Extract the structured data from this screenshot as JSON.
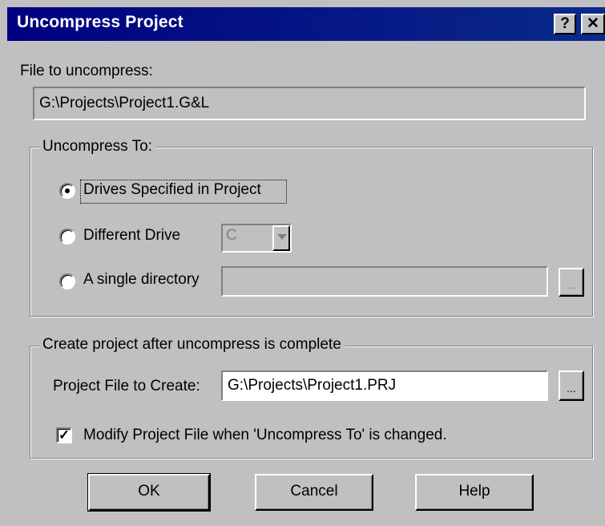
{
  "window": {
    "title": "Uncompress Project",
    "help_glyph": "?",
    "close_glyph": "✕"
  },
  "file_section": {
    "label": "File to uncompress:",
    "value": "G:\\Projects\\Project1.G&L"
  },
  "uncompress_to": {
    "legend": "Uncompress To:",
    "options": [
      {
        "label": "Drives Specified in Project",
        "selected": true
      },
      {
        "label": "Different Drive",
        "selected": false
      },
      {
        "label": "A single directory",
        "selected": false
      }
    ],
    "drive_value": "C",
    "directory_value": "",
    "browse_label": "..."
  },
  "create_project": {
    "legend": "Create project after uncompress is complete",
    "project_file_label": "Project File to Create:",
    "project_file_value": "G:\\Projects\\Project1.PRJ",
    "browse_label": "...",
    "modify_checkbox_label": "Modify Project File when 'Uncompress To'  is changed.",
    "modify_checked": true,
    "check_glyph": "✓"
  },
  "buttons": {
    "ok": "OK",
    "cancel": "Cancel",
    "help": "Help"
  }
}
